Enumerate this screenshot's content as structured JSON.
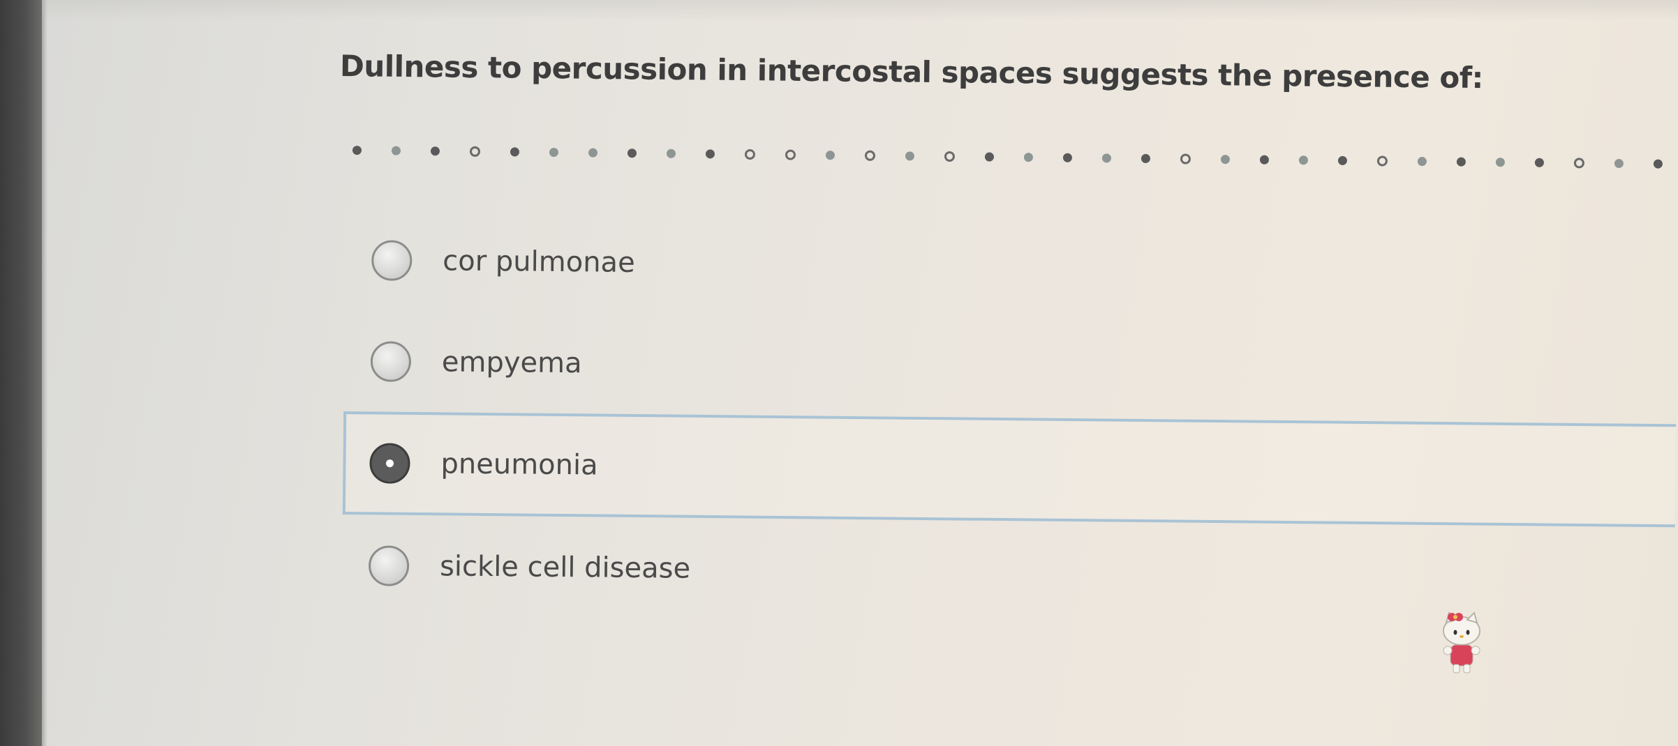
{
  "question": {
    "text": "Dullness to percussion in intercostal spaces suggests the presence of:"
  },
  "options": [
    {
      "label": "cor pulmonae",
      "selected": false
    },
    {
      "label": "empyema",
      "selected": false
    },
    {
      "label": "pneumonia",
      "selected": true
    },
    {
      "label": "sickle cell disease",
      "selected": false
    }
  ],
  "colors": {
    "selection_border": "#a9c3d5",
    "text": "#4a4a4a",
    "background": "#ebe6de"
  },
  "icons": {
    "divider": "dotted-divider",
    "radio": "radio-button",
    "sticker": "cartoon-cat-sticker-icon"
  }
}
